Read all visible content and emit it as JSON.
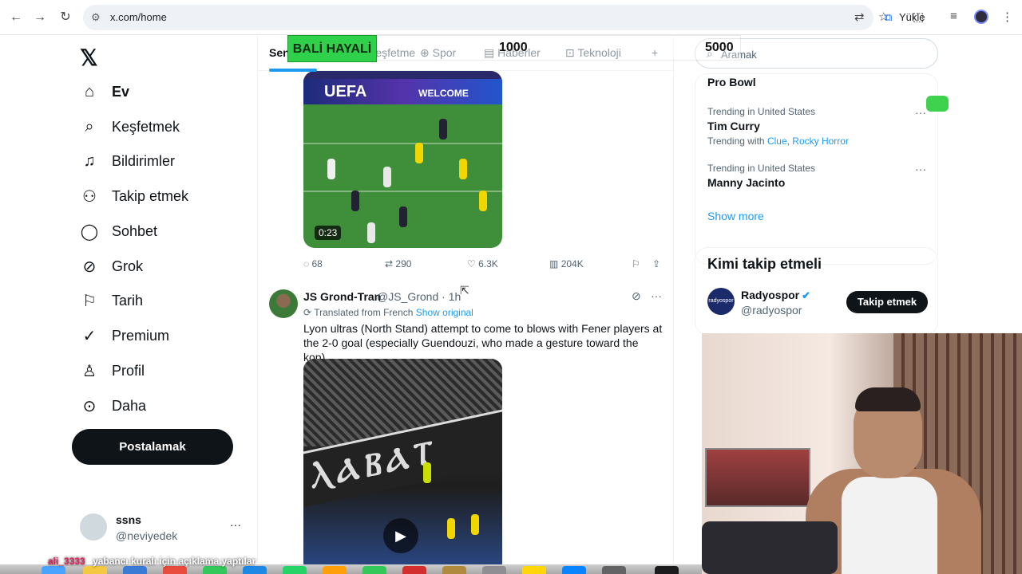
{
  "browser": {
    "url": "x.com/home",
    "yukle_label": "Yükle"
  },
  "sidebar": {
    "items": [
      {
        "label": "Ev",
        "icon": "home-icon"
      },
      {
        "label": "Keşfetmek",
        "icon": "search-icon"
      },
      {
        "label": "Bildirimler",
        "icon": "bell-icon"
      },
      {
        "label": "Takip etmek",
        "icon": "person-add-icon"
      },
      {
        "label": "Sohbet",
        "icon": "chat-icon"
      },
      {
        "label": "Grok",
        "icon": "grok-icon"
      },
      {
        "label": "Tarih",
        "icon": "bookmark-icon"
      },
      {
        "label": "Premium",
        "icon": "verified-icon"
      },
      {
        "label": "Profil",
        "icon": "person-icon"
      },
      {
        "label": "Daha",
        "icon": "more-circle-icon"
      }
    ],
    "post_label": "Postalamak",
    "account": {
      "name": "ssns",
      "handle": "@neviyedek"
    }
  },
  "tabs": [
    "Sen",
    "Keşfetme",
    "Spor",
    "Haberler",
    "Teknoloji",
    "+"
  ],
  "tweet1": {
    "duration": "0:23",
    "banner_text": "UEFA",
    "banner_text2": "WELCOME",
    "replies": "68",
    "retweets": "290",
    "likes": "6.3K",
    "views": "204K"
  },
  "tweet2": {
    "name": "JS Grond-Tran",
    "handle": "@JS_Grond · 1h",
    "translated": "Translated from French",
    "show_original": "Show original",
    "text": "Lyon ultras (North Stand) attempt to come to blows with Fener players at the 2-0 goal (especially Guendouzi, who made a gesture toward the kop)"
  },
  "right": {
    "search_placeholder": "Aramak",
    "trends": [
      {
        "meta": "",
        "title": "Pro Bowl",
        "with": ""
      },
      {
        "meta": "Trending in United States",
        "title": "Tim Curry",
        "with_prefix": "Trending with",
        "with_a": "Clue",
        "with_b": "Rocky Horror"
      },
      {
        "meta": "Trending in United States",
        "title": "Manny Jacinto"
      }
    ],
    "show_more": "Show more",
    "who_to_follow": "Kimi takip etmeli",
    "suggestion": {
      "name": "Radyospor",
      "handle": "@radyospor",
      "avatar_text": "radyospor",
      "button": "Takip etmek"
    }
  },
  "overlay": {
    "bali": "BALİ HAYALİ",
    "n1000": "1000",
    "n5000": "5000",
    "ticker_user": "ali_3333",
    "ticker_text": "yabancı kuralı için açıklama yaptılar"
  },
  "colors": {
    "accent": "#1d9bf0",
    "text": "#0f1419",
    "muted": "#536471",
    "overlay_green": "#2fd14a"
  }
}
